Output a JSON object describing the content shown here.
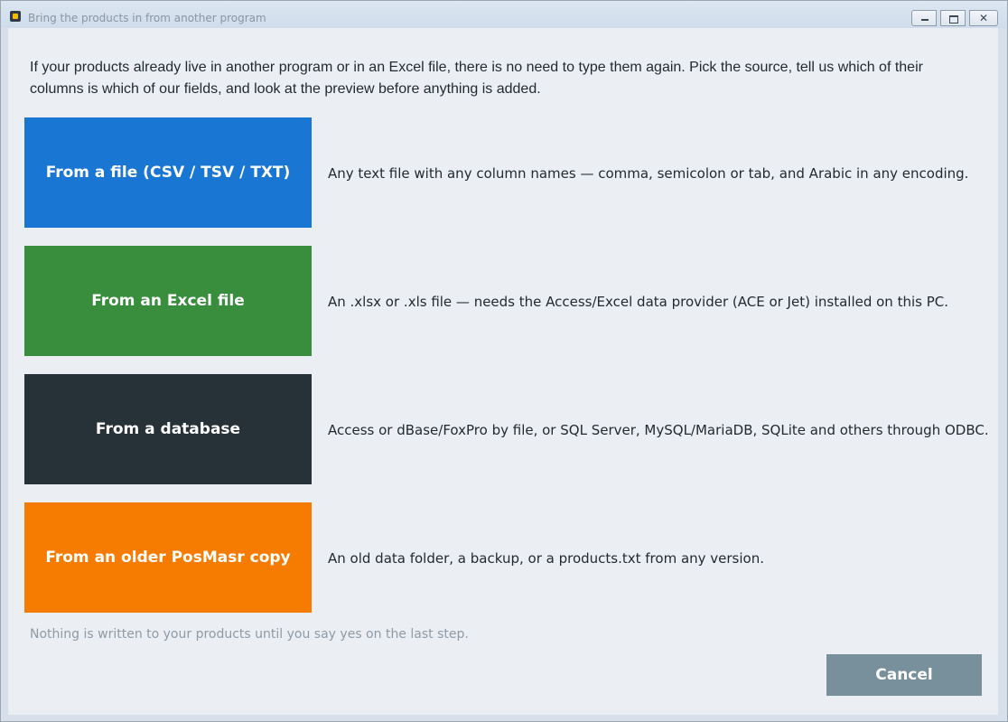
{
  "window": {
    "title": "Bring the products in from another program"
  },
  "intro": "If your products already live in another program or in an Excel file, there is no need to type them again. Pick the source, tell us which of their columns is which of our fields, and look at the preview before anything is added.",
  "sources": [
    {
      "label": "From a file (CSV / TSV / TXT)",
      "description": "Any text file with any column names — comma, semicolon or tab, and Arabic in any encoding.",
      "color": "#1976d2"
    },
    {
      "label": "From an Excel file",
      "description": "An .xlsx or .xls file — needs the Access/Excel data provider (ACE or Jet) installed on this PC.",
      "color": "#388e3c"
    },
    {
      "label": "From a database",
      "description": "Access or dBase/FoxPro by file, or SQL Server, MySQL/MariaDB, SQLite and others through ODBC.",
      "color": "#263238"
    },
    {
      "label": "From an older PosMasr copy",
      "description": "An old data folder, a backup, or a products.txt from any version.",
      "color": "#f57c00"
    }
  ],
  "footnote": "Nothing is written to your products until you say yes on the last step.",
  "cancel_label": "Cancel",
  "colors": {
    "window_bg": "#ebeff3",
    "cancel": "#78909c"
  }
}
